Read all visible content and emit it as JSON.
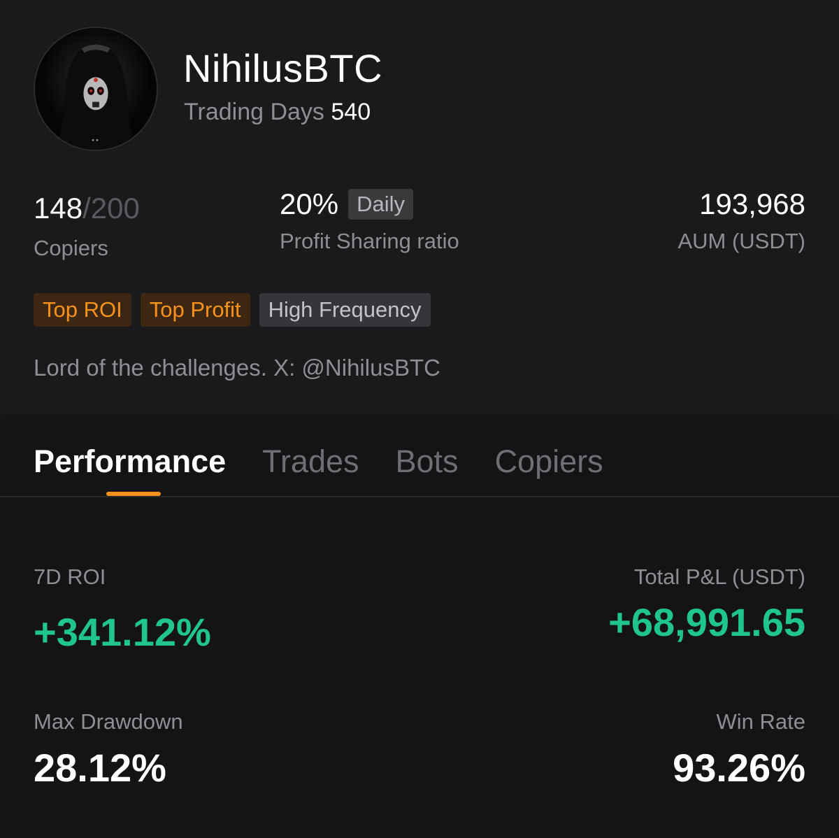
{
  "profile": {
    "name": "NihilusBTC",
    "trading_days_label": "Trading Days",
    "trading_days_value": "540",
    "bio": "Lord of the challenges. X: @NihilusBTC"
  },
  "stats": {
    "copiers_current": "148",
    "copiers_max": "/200",
    "copiers_label": "Copiers",
    "profit_sharing_value": "20%",
    "profit_sharing_period": "Daily",
    "profit_sharing_label": "Profit Sharing ratio",
    "aum_value": "193,968",
    "aum_label": "AUM (USDT)"
  },
  "badges": [
    {
      "label": "Top ROI"
    },
    {
      "label": "Top Profit"
    },
    {
      "label": "High Frequency"
    }
  ],
  "tabs": [
    {
      "label": "Performance",
      "active": true
    },
    {
      "label": "Trades",
      "active": false
    },
    {
      "label": "Bots",
      "active": false
    },
    {
      "label": "Copiers",
      "active": false
    }
  ],
  "performance": {
    "roi_label": "7D ROI",
    "roi_value": "+341.12%",
    "pnl_label": "Total P&L (USDT)",
    "pnl_value": "+68,991.65",
    "max_drawdown_label": "Max Drawdown",
    "max_drawdown_value": "28.12%",
    "win_rate_label": "Win Rate",
    "win_rate_value": "93.26%"
  },
  "colors": {
    "accent": "#f7931a",
    "positive": "#20c58b",
    "background": "#161618"
  }
}
